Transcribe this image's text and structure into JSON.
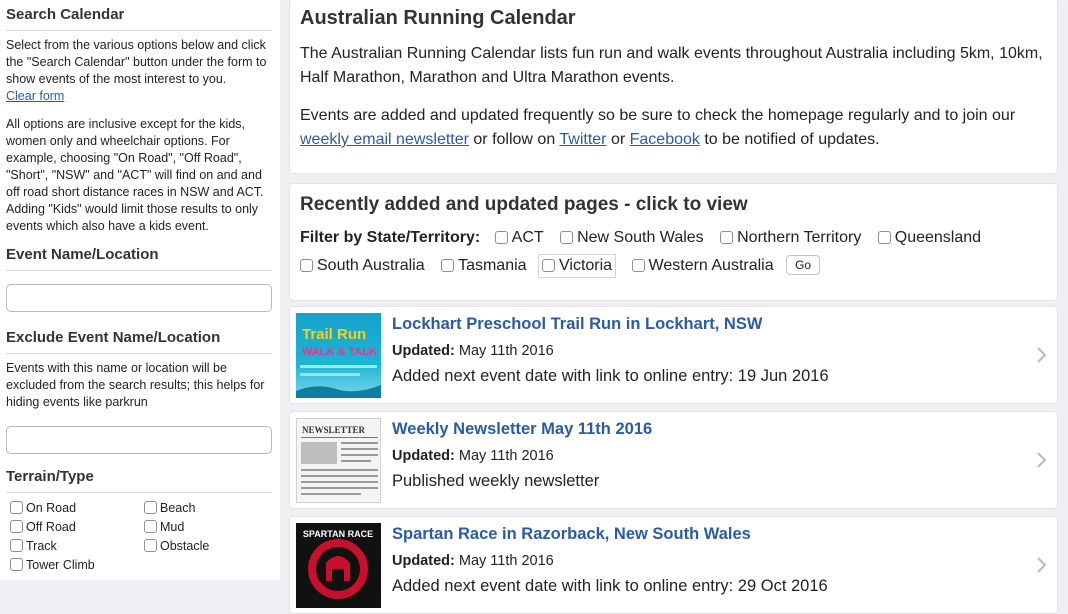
{
  "sidebar": {
    "search_heading": "Search Calendar",
    "intro": "Select from the various options below and click the \"Search Calendar\" button under the form to show events of the most interest to you.",
    "clear_form": "Clear form",
    "inclusive_note": "All options are inclusive except for the kids, women only and wheelchair options. For example, choosing \"On Road\", \"Off Road\", \"Short\", \"NSW\" and \"ACT\" will find on and and off road short distance races in NSW and ACT. Adding \"Kids\" would limit those results to only events which also have a kids event.",
    "event_name_heading": "Event Name/Location",
    "event_name_value": "",
    "exclude_heading": "Exclude Event Name/Location",
    "exclude_note": "Events with this name or location will be excluded from the search results; this helps for hiding events like parkrun",
    "exclude_value": "",
    "terrain_heading": "Terrain/Type",
    "terrain_options": [
      "On Road",
      "Beach",
      "Off Road",
      "Mud",
      "Track",
      "Obstacle",
      "Tower Climb"
    ]
  },
  "intro_card": {
    "title": "Australian Running Calendar",
    "para1": "The Australian Running Calendar lists fun run and walk events throughout Australia including 5km, 10km, Half Marathon, Marathon and Ultra Marathon events.",
    "para2_prefix": "Events are added and updated frequently so be sure to check the homepage regularly and to join our ",
    "newsletter_link": "weekly email newsletter",
    "para2_mid1": " or follow on ",
    "twitter_link": "Twitter",
    "para2_mid2": " or ",
    "facebook_link": "Facebook",
    "para2_suffix": " to be notified of updates."
  },
  "recent_card": {
    "title": "Recently added and updated pages - click to view",
    "filter_label": "Filter by State/Territory:",
    "states": [
      "ACT",
      "New South Wales",
      "Northern Territory",
      "Queensland",
      "South Australia",
      "Tasmania",
      "Victoria",
      "Western Australia"
    ],
    "go_label": "Go"
  },
  "updates": [
    {
      "title": "Lockhart Preschool Trail Run in Lockhart, NSW",
      "updated_label": "Updated:",
      "updated_date": "May 11th 2016",
      "description": "Added next event date with link to online entry: 19 Jun 2016",
      "thumb_icon": "trail-run-poster-icon",
      "thumb_text_a": "Trail Run",
      "thumb_text_b": "WALK & TALK"
    },
    {
      "title": "Weekly Newsletter May 11th 2016",
      "updated_label": "Updated:",
      "updated_date": "May 11th 2016",
      "description": "Published weekly newsletter",
      "thumb_icon": "newspaper-icon",
      "thumb_text_a": "NEWSLETTER"
    },
    {
      "title": "Spartan Race in Razorback, New South Wales",
      "updated_label": "Updated:",
      "updated_date": "May 11th 2016",
      "description": "Added next event date with link to online entry: 29 Oct 2016",
      "thumb_icon": "spartan-race-logo-icon",
      "thumb_text_a": "SPARTAN RACE"
    }
  ],
  "colors": {
    "link": "#2a5ba8",
    "background": "#efeff4",
    "card": "#ffffff"
  }
}
